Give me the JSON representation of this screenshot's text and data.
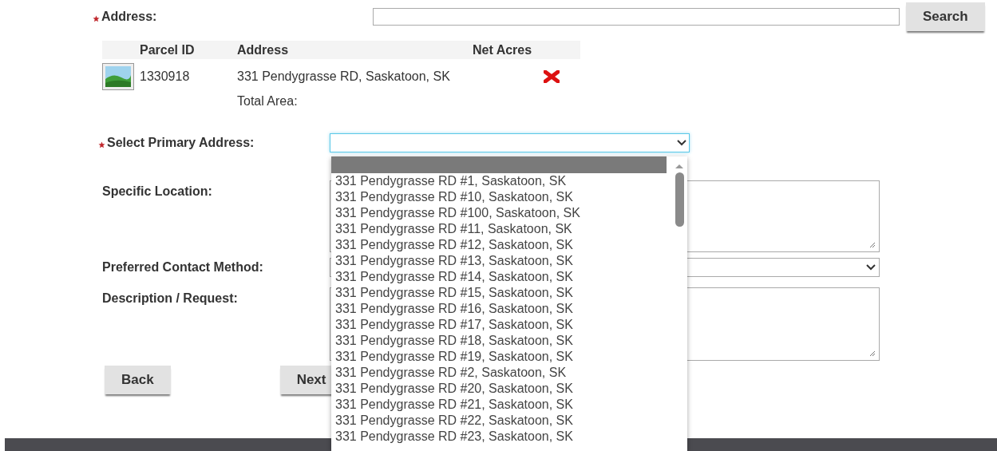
{
  "address_search": {
    "label": "Address:",
    "required": true,
    "button": "Search"
  },
  "parcels": {
    "columns": [
      "Parcel ID",
      "Address",
      "Net Acres"
    ],
    "rows": [
      {
        "parcel_id": "1330918",
        "address": "331 Pendygrasse RD, Saskatoon, SK"
      }
    ],
    "total_label": "Total Area:"
  },
  "primary_address": {
    "label": "Select Primary Address:",
    "required": true,
    "open": true,
    "options": [
      {
        "selected": true
      },
      {
        "label": "331 Pendygrasse RD #1, Saskatoon, SK",
        "selected": false
      },
      {
        "label": "331 Pendygrasse RD #10, Saskatoon, SK",
        "selected": false
      },
      {
        "label": "331 Pendygrasse RD #100, Saskatoon, SK",
        "selected": false
      },
      {
        "label": "331 Pendygrasse RD #11, Saskatoon, SK",
        "selected": false
      },
      {
        "label": "331 Pendygrasse RD #12, Saskatoon, SK",
        "selected": false
      },
      {
        "label": "331 Pendygrasse RD #13, Saskatoon, SK",
        "selected": false
      },
      {
        "label": "331 Pendygrasse RD #14, Saskatoon, SK",
        "selected": false
      },
      {
        "label": "331 Pendygrasse RD #15, Saskatoon, SK",
        "selected": false
      },
      {
        "label": "331 Pendygrasse RD #16, Saskatoon, SK",
        "selected": false
      },
      {
        "label": "331 Pendygrasse RD #17, Saskatoon, SK",
        "selected": false
      },
      {
        "label": "331 Pendygrasse RD #18, Saskatoon, SK",
        "selected": false
      },
      {
        "label": "331 Pendygrasse RD #19, Saskatoon, SK",
        "selected": false
      },
      {
        "label": "331 Pendygrasse RD #2, Saskatoon, SK",
        "selected": false
      },
      {
        "label": "331 Pendygrasse RD #20, Saskatoon, SK",
        "selected": false
      },
      {
        "label": "331 Pendygrasse RD #21, Saskatoon, SK",
        "selected": false
      },
      {
        "label": "331 Pendygrasse RD #22, Saskatoon, SK",
        "selected": false
      },
      {
        "label": "331 Pendygrasse RD #23, Saskatoon, SK",
        "selected": false
      }
    ]
  },
  "fields": [
    {
      "kind": "textarea",
      "label": "Specific Location:"
    },
    {
      "kind": "select",
      "label": "Preferred Contact Method:"
    },
    {
      "kind": "textarea",
      "label": "Description / Request:"
    }
  ],
  "buttons": [
    "Back",
    "Next"
  ]
}
